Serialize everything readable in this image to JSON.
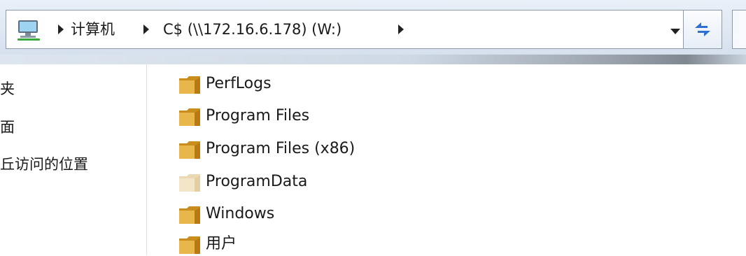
{
  "address_bar": {
    "crumbs": [
      "计算机",
      "C$ (\\\\172.16.6.178) (W:)"
    ],
    "computer_icon": "network-computer-icon",
    "dropdown_icon": "chevron-down-icon",
    "refresh_icon": "refresh-icon"
  },
  "nav_pane": {
    "items": [
      {
        "label": "夹"
      },
      {
        "label": "面"
      },
      {
        "label": "丘访问的位置"
      }
    ]
  },
  "files": [
    {
      "name": "PerfLogs",
      "icon": "folder-icon",
      "faded": false
    },
    {
      "name": "Program Files",
      "icon": "folder-icon",
      "faded": false
    },
    {
      "name": "Program Files (x86)",
      "icon": "folder-icon",
      "faded": false
    },
    {
      "name": "ProgramData",
      "icon": "folder-icon",
      "faded": true
    },
    {
      "name": "Windows",
      "icon": "folder-icon",
      "faded": false
    },
    {
      "name": "用户",
      "icon": "folder-icon",
      "faded": false
    }
  ],
  "colors": {
    "folder_body": "#e8b64a",
    "folder_dark": "#c98d1c",
    "folder_faded": "#f1e4c4",
    "refresh_arrow": "#2f6fd0"
  }
}
